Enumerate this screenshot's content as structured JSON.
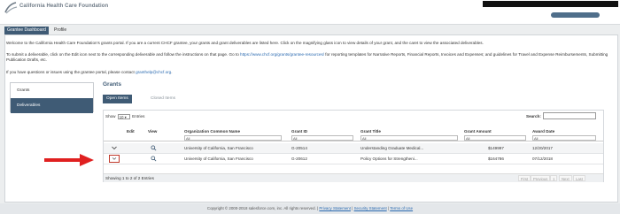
{
  "header": {
    "logo_text": "California Health Care Foundation",
    "brand_color": "#3f5b75"
  },
  "nav_tabs": {
    "active": "Grantee Dashboard",
    "inactive": "Profile"
  },
  "intro": {
    "p1": "Welcome to the California Health Care Foundation's grants portal. If you are a current CHCF grantee, your grants and grant deliverables are listed here. Click on the magnifying glass icon to view details of your grant, and the caret to view the associated deliverables.",
    "p2_before": "To submit a deliverable, click on the Edit icon next to the corresponding deliverable and follow the instructions on that page. Go to ",
    "p2_link": "https://www.chcf.org/grants/grantee-resources/",
    "p2_after": " for reporting templates for Narrative Reports, Financial Reports, Invoices and Expenses; and guidelines for Travel and Expense Reimbursements, Submitting Publication Drafts, etc.",
    "p3_before": "If you have questions or issues using the grantee portal, please contact ",
    "p3_link": "granthelp@chcf.org",
    "p3_after": "."
  },
  "sidebar": {
    "items": [
      {
        "label": "Grants"
      },
      {
        "label": "Deliverables"
      }
    ]
  },
  "grants": {
    "title": "Grants",
    "tabs": {
      "open": "Open Items",
      "closed": "Closed Items"
    },
    "show_label": "Show",
    "show_value": "10",
    "entries_label": "Entries",
    "search_label": "Search:",
    "columns": {
      "edit": "Edit",
      "view": "View",
      "org": "Organization Common Name",
      "grant_id": "Grant ID",
      "grant_title": "Grant Title",
      "grant_amount": "Grant Amount",
      "award_date": "Award Date"
    },
    "filter_all": "All",
    "rows": [
      {
        "org": "University of California, San Francisco",
        "grant_id": "G-20514",
        "grant_title": "Understanding Graduate Medical...",
        "grant_amount": "$149997",
        "award_date": "12/20/2017"
      },
      {
        "org": "University of California, San Francisco",
        "grant_id": "G-20612",
        "grant_title": "Policy Options for Strengtheni...",
        "grant_amount": "$164786",
        "award_date": "07/12/2018"
      }
    ],
    "showing_text": "Showing 1 to 2 of 2 Entries",
    "pager": {
      "first": "First",
      "previous": "Previous",
      "page": "1",
      "next": "Next",
      "last": "Last"
    }
  },
  "footer": {
    "copyright": "Copyright © 2000-2018 salesforce.com, inc. All rights reserved.",
    "privacy": "Privacy Statement",
    "security": "Security Statement",
    "terms": "Terms of Use"
  }
}
